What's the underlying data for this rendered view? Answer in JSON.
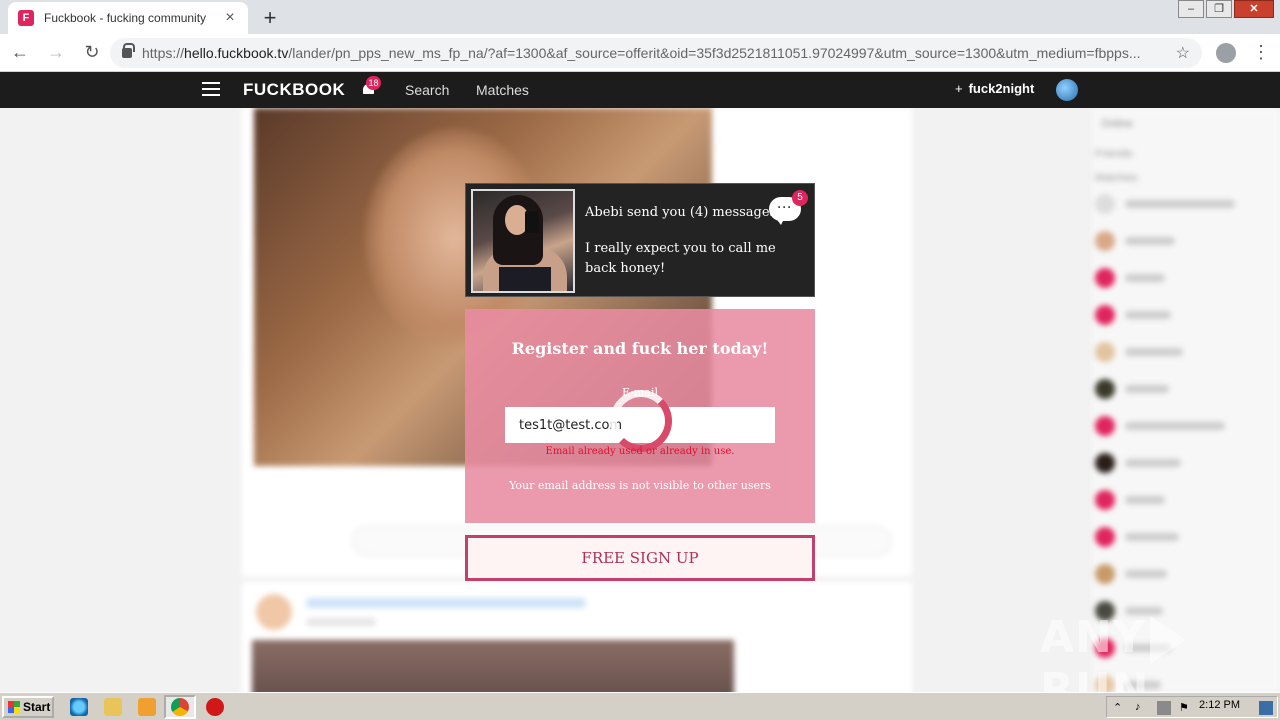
{
  "browser": {
    "tab_title": "Fuckbook - fucking community",
    "favicon_letter": "F",
    "url_scheme": "https://",
    "url_host": "hello.fuckbook.tv",
    "url_rest": "/lander/pn_pps_new_ms_fp_na/?af=1300&af_source=offerit&oid=35f3d2521811051.97024997&utm_source=1300&utm_medium=fbpps..."
  },
  "header": {
    "logo": "FUCKBOOK",
    "notification_count": "18",
    "nav": [
      "Search",
      "Matches"
    ],
    "cta_plus": "+",
    "cta_label": "fuck2night"
  },
  "sidebar": {
    "online_label": "Online",
    "friends_label": "Friends:",
    "matches_label": "Matches:"
  },
  "notification": {
    "title": "Abebi send you (4) messages",
    "message": "I really expect you to call me back honey!",
    "badge": "5"
  },
  "register": {
    "title": "Register and fuck her today!",
    "email_label": "E-mail",
    "email_value": "tes1t@test.com",
    "email_error": "Email already used or already in use.",
    "privacy_note": "Your email address is not visible to other users",
    "signup_button": "FREE SIGN UP"
  },
  "watermark": {
    "left": "ANY",
    "right": "RUN"
  },
  "taskbar": {
    "start_label": "Start",
    "clock": "2:12 PM"
  },
  "colors": {
    "brand_pink": "#e0245e",
    "register_bg": "#e88ca2",
    "signup_border": "#c4406a",
    "header_bg": "#1c1c1c"
  }
}
